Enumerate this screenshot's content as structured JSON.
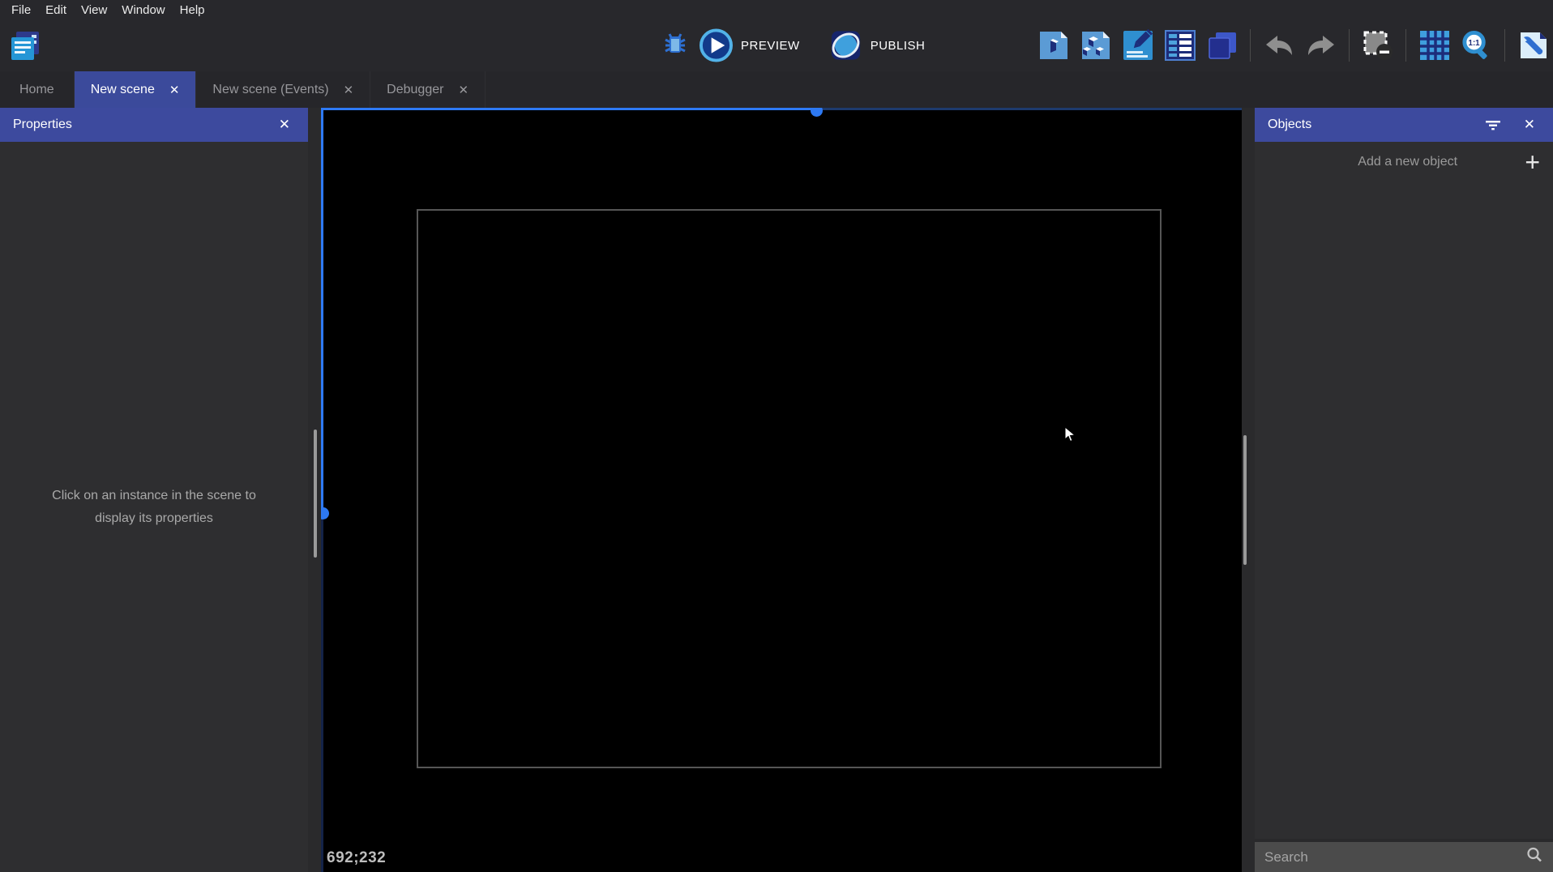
{
  "menu": {
    "items": [
      "File",
      "Edit",
      "View",
      "Window",
      "Help"
    ]
  },
  "toolbar": {
    "preview_label": "PREVIEW",
    "publish_label": "PUBLISH",
    "left_icon": "project-manager-icon",
    "center_icons": [
      "debug-icon",
      "preview-play-icon",
      "publish-globe-icon"
    ],
    "right_icons": [
      "object-icon",
      "objects-group-icon",
      "edit-scene-icon",
      "layers-icon",
      "instances-icon",
      "undo-icon",
      "redo-icon",
      "deselect-icon",
      "grid-icon",
      "zoom-1-1-icon",
      "settings-wrench-icon"
    ]
  },
  "tabs": [
    {
      "label": "Home",
      "active": false,
      "closable": false
    },
    {
      "label": "New scene",
      "active": true,
      "closable": true
    },
    {
      "label": "New scene (Events)",
      "active": false,
      "closable": true
    },
    {
      "label": "Debugger",
      "active": false,
      "closable": true
    }
  ],
  "properties_panel": {
    "title": "Properties",
    "empty_message": "Click on an instance in the scene to display its properties"
  },
  "objects_panel": {
    "title": "Objects",
    "add_label": "Add a new object",
    "search_placeholder": "Search",
    "header_icons": [
      "filter-icon",
      "close-icon"
    ]
  },
  "canvas": {
    "coordinates": "692;232"
  },
  "ui": {
    "close_glyph": "✕",
    "plus_glyph": "+"
  },
  "colors": {
    "accent_blue": "#3d4a9e",
    "selection_blue": "#2e7af5",
    "selection_blue_dim": "#1d3a6d",
    "panel_bg": "#2e2e30",
    "topbar_bg": "#28282c",
    "canvas_bg": "#000000",
    "search_bg": "#4b4b4b",
    "frame_border": "#565656"
  }
}
